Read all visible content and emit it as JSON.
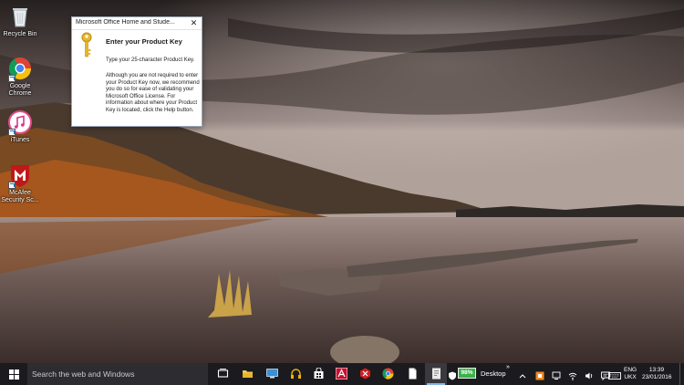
{
  "desktop_icons": [
    {
      "label": "Recycle Bin",
      "icon": "recycle-bin-icon"
    },
    {
      "label": "Google Chrome",
      "icon": "chrome-icon"
    },
    {
      "label": "iTunes",
      "icon": "itunes-icon"
    },
    {
      "label": "McAfee Security Sc...",
      "icon": "mcafee-icon"
    }
  ],
  "dialog": {
    "title": "Microsoft Office Home and Stude...",
    "close_glyph": "✕",
    "heading": "Enter your Product Key",
    "line": "Type your 25-character Product Key.",
    "paragraph": "Although you are not required to enter your Product Key now, we recommend you do so for ease of validating your Microsoft Office License. For information about where your Product Key is located, click the Help button.",
    "icon": "key-icon"
  },
  "taskbar": {
    "search_placeholder": "Search the web and Windows",
    "pinned": [
      {
        "name": "task-view-icon"
      },
      {
        "name": "file-explorer-icon"
      },
      {
        "name": "remote-desktop-icon"
      },
      {
        "name": "headphones-icon"
      },
      {
        "name": "store-icon"
      },
      {
        "name": "acrobat-icon"
      },
      {
        "name": "app-red-icon"
      },
      {
        "name": "chrome-icon"
      },
      {
        "name": "document-icon"
      },
      {
        "name": "office-setup-icon"
      }
    ],
    "battery_percent": "98%",
    "desktop_label": "Desktop",
    "chevron": "»",
    "tray": [
      "caret-up-icon",
      "notification-app-icon",
      "network-icon",
      "wifi-icon",
      "volume-icon",
      "action-center-icon",
      "keyboard-icon"
    ],
    "lang_top": "ENG",
    "lang_bottom": "UKX",
    "time": "13:39",
    "date": "23/01/2016"
  },
  "colors": {
    "taskbar": "#1b1a1e",
    "search_box": "#2d2c31",
    "active_indicator": "#86b6ea",
    "battery": "#3bb34a"
  }
}
